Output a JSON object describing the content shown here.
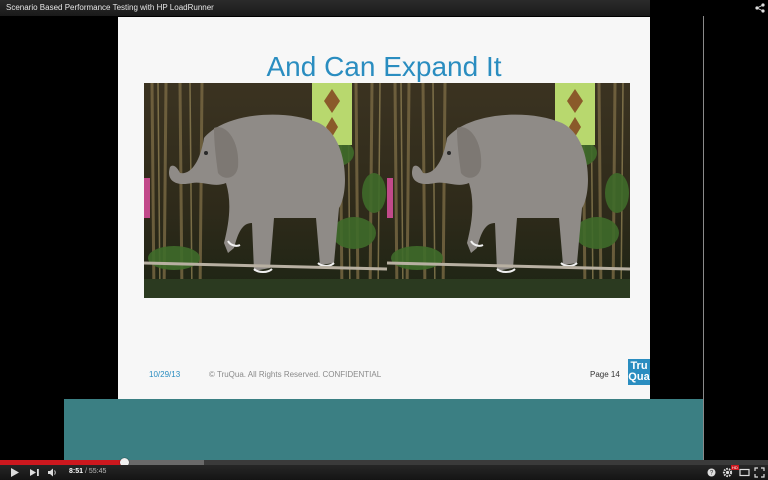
{
  "video": {
    "title": "Scenario Based Performance Testing with HP LoadRunner"
  },
  "slide": {
    "heading": "And Can Expand It",
    "footer": {
      "date": "10/29/13",
      "copyright": "© TruQua. All Rights Reserved. CONFIDENTIAL",
      "page": "Page 14"
    },
    "logo_text": "TruQua"
  },
  "player": {
    "current_time": "8:51",
    "separator": "/",
    "total_time": "55:45",
    "progress_played_fraction": 0.162,
    "progress_loaded_fraction": 0.265,
    "hd_badge": "HD"
  },
  "colors": {
    "slide_accent": "#2a8dc0",
    "progress_red": "#cc181e",
    "teal_band": "#3b7f83"
  },
  "icons": {
    "share": "share-icon",
    "play": "play-icon",
    "next": "next-icon",
    "volume": "volume-icon",
    "help": "help-icon",
    "settings": "gear-icon",
    "theater": "theater-mode-icon",
    "fullscreen": "fullscreen-icon"
  }
}
